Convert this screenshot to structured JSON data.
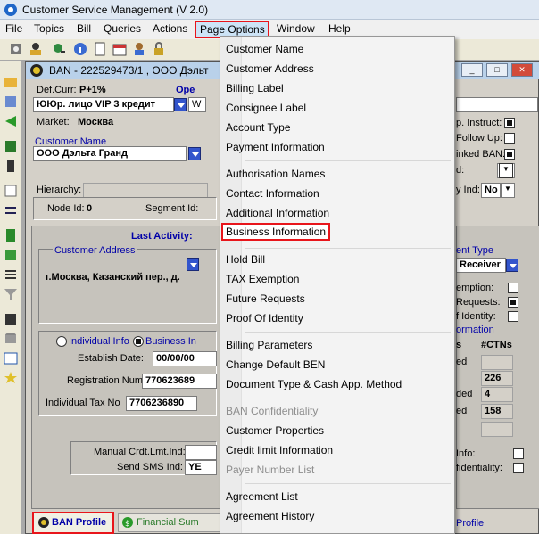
{
  "window": {
    "title": "Customer Service Management  (V 2.0)"
  },
  "menubar": {
    "items": [
      "File",
      "Topics",
      "Bill",
      "Queries",
      "Actions",
      "Page Options",
      "Window",
      "Help"
    ]
  },
  "child": {
    "title": "BAN - 222529473/1 , OOO Дэльт",
    "def_curr_label": "Def.Curr:",
    "def_curr_value": "P+1%",
    "oper_label": "Ope",
    "account_type_value": "ЮЮр. лицо VIP 3  кредит",
    "account_type_extra": "W",
    "market_label": "Market:",
    "market_value": "Москва",
    "customer_name_label": "Customer Name",
    "customer_name_value": "ООО Дэльта Гранд",
    "hierarchy_label": "Hierarchy:",
    "node_id_label": "Node Id:",
    "node_id_value": "0",
    "segment_id_label": "Segment Id:",
    "last_activity_label": "Last Activity:",
    "customer_address_label": "Customer Address",
    "customer_address_value": "г.Москва, Казанский пер., д.",
    "radio_individual": "Individual Info",
    "radio_business": "Business In",
    "establish_date_label": "Establish Date:",
    "establish_date_value": "00/00/00",
    "registration_num_label": "Registration Num:",
    "registration_num_value": "770623689",
    "individual_tax_label": "Individual Tax No",
    "individual_tax_value": "7706236890",
    "manual_crdt_label": "Manual Crdt.Lmt.Ind:",
    "send_sms_label": "Send SMS Ind:",
    "send_sms_value": "YE",
    "right": {
      "instruct": "p. Instruct:",
      "follow_up": "Follow Up:",
      "linked_ban": "inked BAN:",
      "d_label": "d:",
      "ind_label": "y Ind:",
      "ind_value": "No",
      "ent_type": "ent Type",
      "receiver": "Receiver",
      "exemption": "emption:",
      "requests": "Requests:",
      "identity": "f Identity:",
      "ormation": "ormation",
      "col_s": "s",
      "col_ctns": "#CTNs",
      "row1_label": "ed",
      "row2_value": "226",
      "row3_label": "ded",
      "row3_value": "4",
      "row4_label": "ed",
      "row4_value": "158",
      "info": "Info:",
      "fidentiality": "fidentiality:",
      "profile_tab": "Profile"
    }
  },
  "tabs": {
    "ban_profile": "BAN Profile",
    "financial_summary": "Financial Sum"
  },
  "dropdown": {
    "groups": [
      [
        "Customer Name",
        "Customer Address",
        "Billing Label",
        "Consignee Label",
        "Account Type",
        "Payment Information"
      ],
      [
        "Authorisation Names",
        "Contact Information",
        "Additional Information",
        "Business Information"
      ],
      [
        "Hold Bill",
        "TAX Exemption",
        "Future Requests",
        "Proof Of Identity"
      ],
      [
        "Billing Parameters",
        "Change Default BEN",
        "Document Type & Cash App. Method"
      ],
      [
        "BAN Confidentiality",
        "Customer Properties",
        "Credit limit Information",
        "Payer Number List"
      ],
      [
        "Agreement List",
        "Agreement History"
      ]
    ]
  },
  "colors": {
    "highlight": "#e8151b",
    "blue_label": "#0000a8",
    "dropdown_bg": "#f3f3f3"
  }
}
